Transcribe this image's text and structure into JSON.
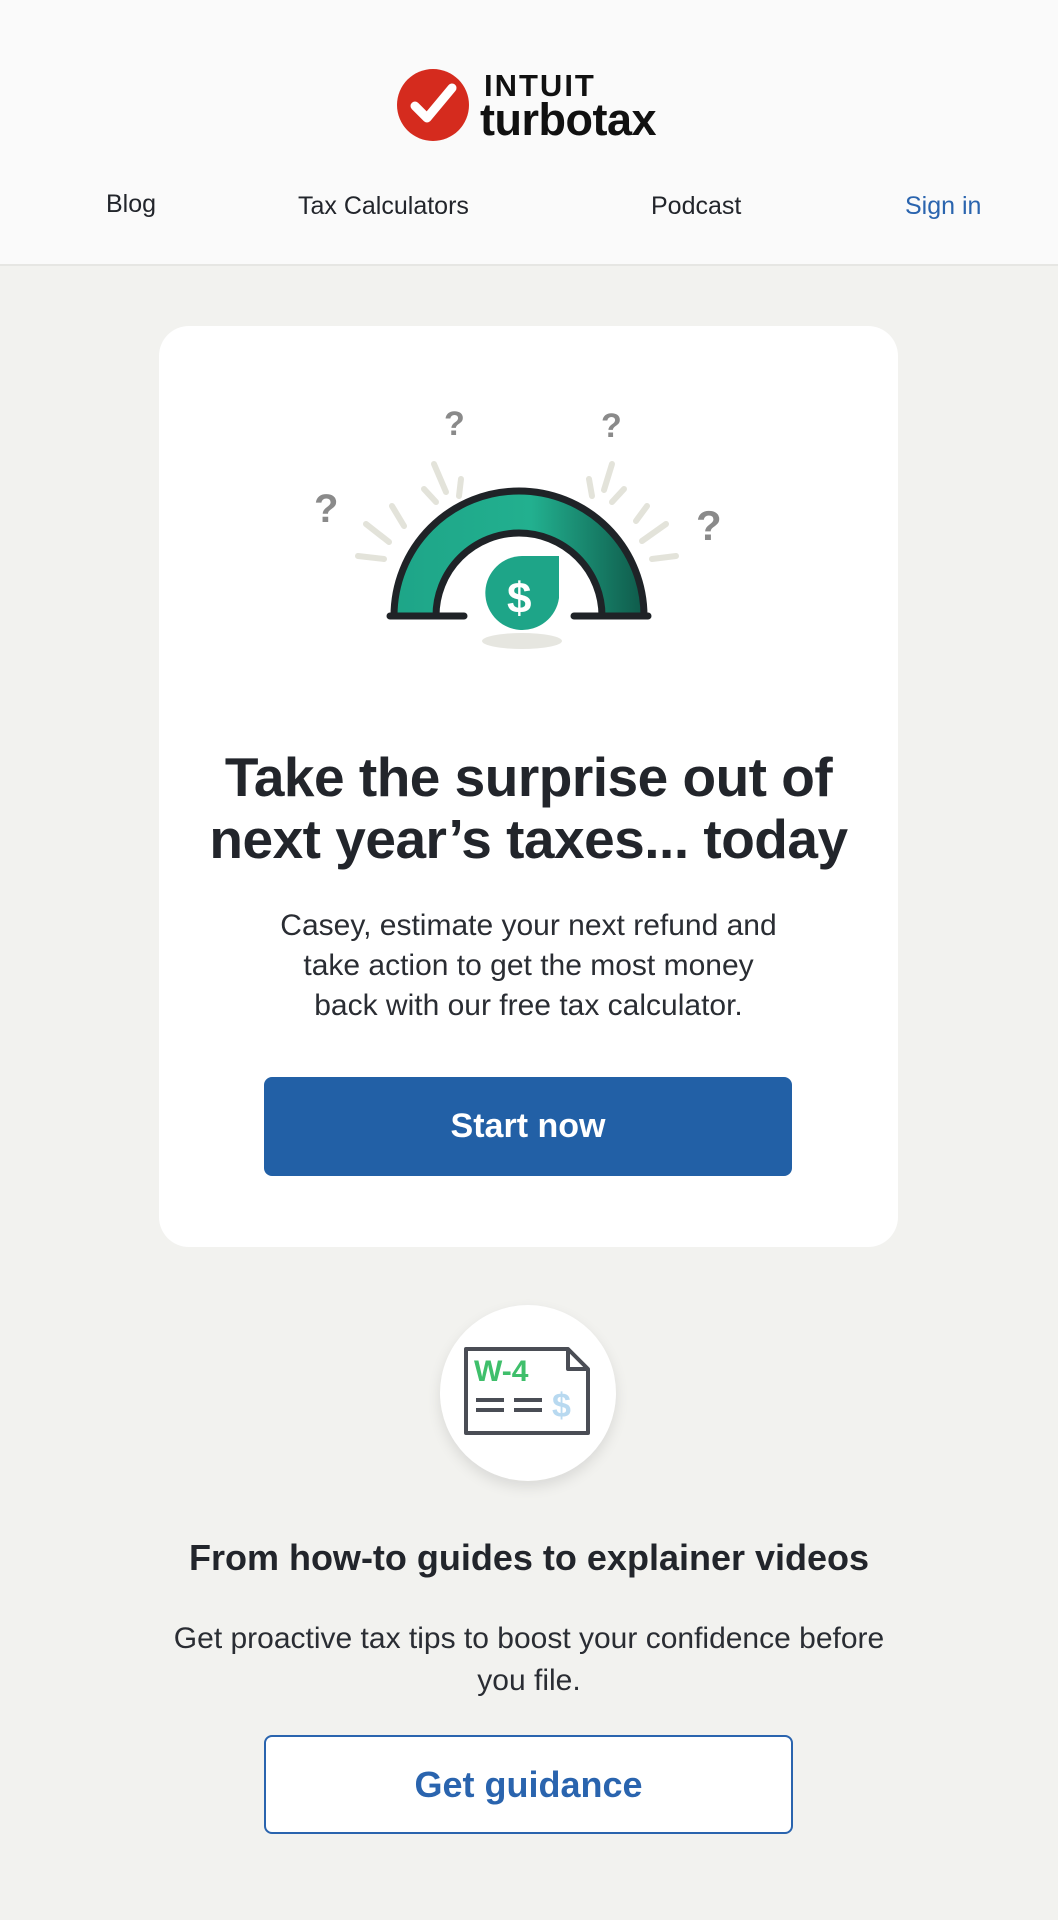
{
  "header": {
    "logo_top": "INTUIT",
    "logo_bottom": "turbotax",
    "nav": {
      "blog": "Blog",
      "tax_calculators": "Tax Calculators",
      "podcast": "Podcast",
      "sign_in": "Sign in"
    }
  },
  "hero": {
    "title_line1": "Take the surprise out of",
    "title_line2": "next year’s taxes... today",
    "body_line1": "Casey, estimate your next refund and",
    "body_line2": "take action to get the most money",
    "body_line3": "back with our free tax calculator.",
    "button_label": "Start now",
    "illustration": {
      "question_mark": "?",
      "dollar_symbol": "$"
    }
  },
  "guidance": {
    "icon_text": "W-4",
    "icon_dollar": "$",
    "title": "From how-to guides to explainer videos",
    "body_line1": "Get proactive tax tips to boost your confidence before",
    "body_line2": "you file.",
    "button_label": "Get guidance"
  },
  "colors": {
    "primary_blue": "#2260a6",
    "link_blue": "#2a64ae",
    "turbotax_red": "#d52b1e",
    "gauge_green": "#1ea588",
    "page_bg": "#f2f2ef",
    "w4_green": "#3fbf6b"
  }
}
